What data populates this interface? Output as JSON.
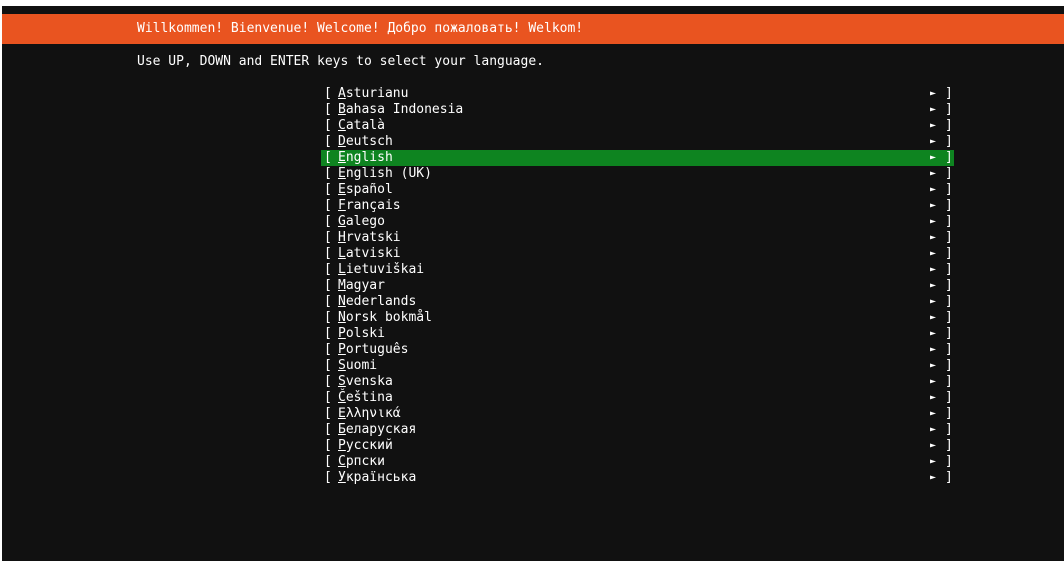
{
  "header": {
    "title": "Willkommen! Bienvenue! Welcome! Добро пожаловать! Welkom!"
  },
  "instructions": "Use UP, DOWN and ENTER keys to select your language.",
  "colors": {
    "header_bg": "#e95420",
    "screen_bg": "#111111",
    "selected_bg": "#0e8420",
    "text": "#ffffff"
  },
  "icons": {
    "item_arrow": "triangle-right-icon"
  },
  "list": {
    "bracket_open": "[",
    "bracket_close": "]",
    "arrow_glyph": "►",
    "selected_index": 4,
    "items": [
      {
        "label": "Asturianu"
      },
      {
        "label": "Bahasa Indonesia"
      },
      {
        "label": "Català"
      },
      {
        "label": "Deutsch"
      },
      {
        "label": "English"
      },
      {
        "label": "English (UK)"
      },
      {
        "label": "Español"
      },
      {
        "label": "Français"
      },
      {
        "label": "Galego"
      },
      {
        "label": "Hrvatski"
      },
      {
        "label": "Latviski"
      },
      {
        "label": "Lietuviškai"
      },
      {
        "label": "Magyar"
      },
      {
        "label": "Nederlands"
      },
      {
        "label": "Norsk bokmål"
      },
      {
        "label": "Polski"
      },
      {
        "label": "Português"
      },
      {
        "label": "Suomi"
      },
      {
        "label": "Svenska"
      },
      {
        "label": "Čeština"
      },
      {
        "label": "Ελληνικά"
      },
      {
        "label": "Беларуская"
      },
      {
        "label": "Русский"
      },
      {
        "label": "Српски"
      },
      {
        "label": "Українська"
      }
    ]
  }
}
